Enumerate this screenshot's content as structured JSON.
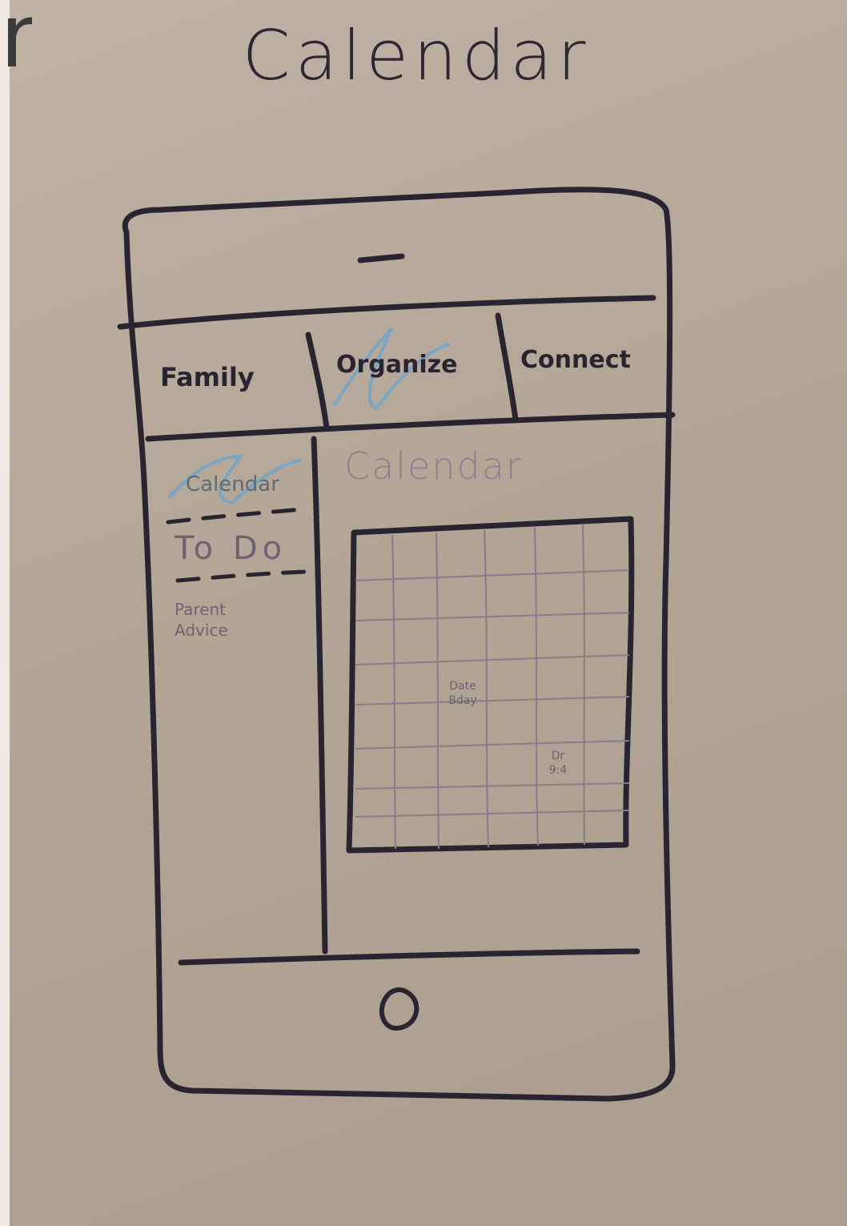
{
  "title": "Calendar",
  "tabs": [
    {
      "label": "Family"
    },
    {
      "label": "Organize"
    },
    {
      "label": "Connect"
    }
  ],
  "sidebar": {
    "items": [
      {
        "label": "Calendar"
      },
      {
        "label": "To Do"
      },
      {
        "label": "Parent Advice"
      }
    ]
  },
  "content": {
    "title": "Calendar",
    "notes": [
      {
        "line1": "Date",
        "line2": "Bday"
      },
      {
        "line1": "Dr",
        "line2": "9:4"
      }
    ]
  },
  "colors": {
    "paper": "#b8ab9d",
    "ink": "#2b2530",
    "highlight": "#7aa6c4",
    "pencil": "#6c6470"
  },
  "icons": [
    "speaker-slot-icon",
    "home-button-icon"
  ]
}
